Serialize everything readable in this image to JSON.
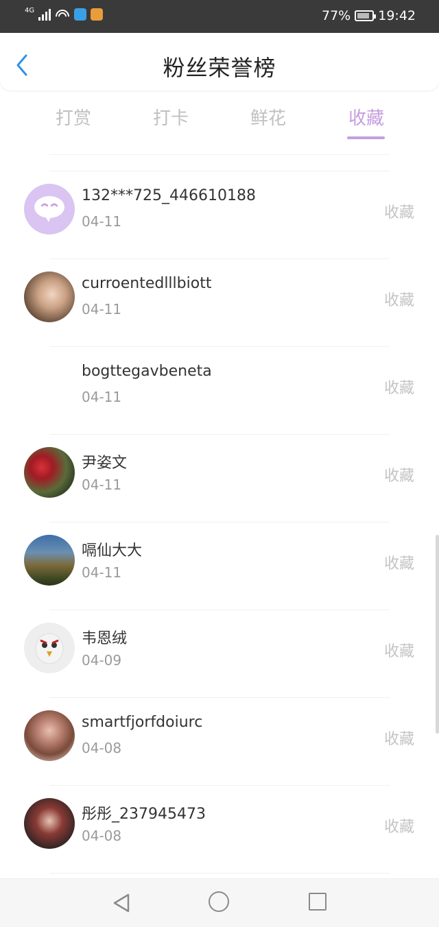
{
  "status_bar": {
    "network": "4G",
    "battery_percent": "77%",
    "time": "19:42"
  },
  "header": {
    "back_icon": "chevron-left-icon",
    "title": "粉丝荣誉榜"
  },
  "tabs": [
    {
      "label": "打赏",
      "active": false
    },
    {
      "label": "打卡",
      "active": false
    },
    {
      "label": "鲜花",
      "active": false
    },
    {
      "label": "收藏",
      "active": true
    }
  ],
  "list": [
    {
      "name": "132***725_446610188",
      "date": "04-11",
      "action": "收藏",
      "avatar": "chat-bubble-avatar"
    },
    {
      "name": "curroentedlllbiott",
      "date": "04-11",
      "action": "收藏",
      "avatar": "photo-avatar"
    },
    {
      "name": "bogttegavbeneta",
      "date": "04-11",
      "action": "收藏",
      "avatar": "blank-avatar"
    },
    {
      "name": "尹姿文",
      "date": "04-11",
      "action": "收藏",
      "avatar": "berries-avatar"
    },
    {
      "name": "嗝仙大大",
      "date": "04-11",
      "action": "收藏",
      "avatar": "windmill-avatar"
    },
    {
      "name": "韦恩绒",
      "date": "04-09",
      "action": "收藏",
      "avatar": "cartoon-avatar"
    },
    {
      "name": "smartfjorfdoiurc",
      "date": "04-08",
      "action": "收藏",
      "avatar": "portrait-avatar"
    },
    {
      "name": "彤彤_237945473",
      "date": "04-08",
      "action": "收藏",
      "avatar": "portrait-avatar"
    }
  ],
  "colors": {
    "accent": "#c59de0",
    "back_blue": "#2f93e8",
    "muted": "#c4c4c4"
  }
}
